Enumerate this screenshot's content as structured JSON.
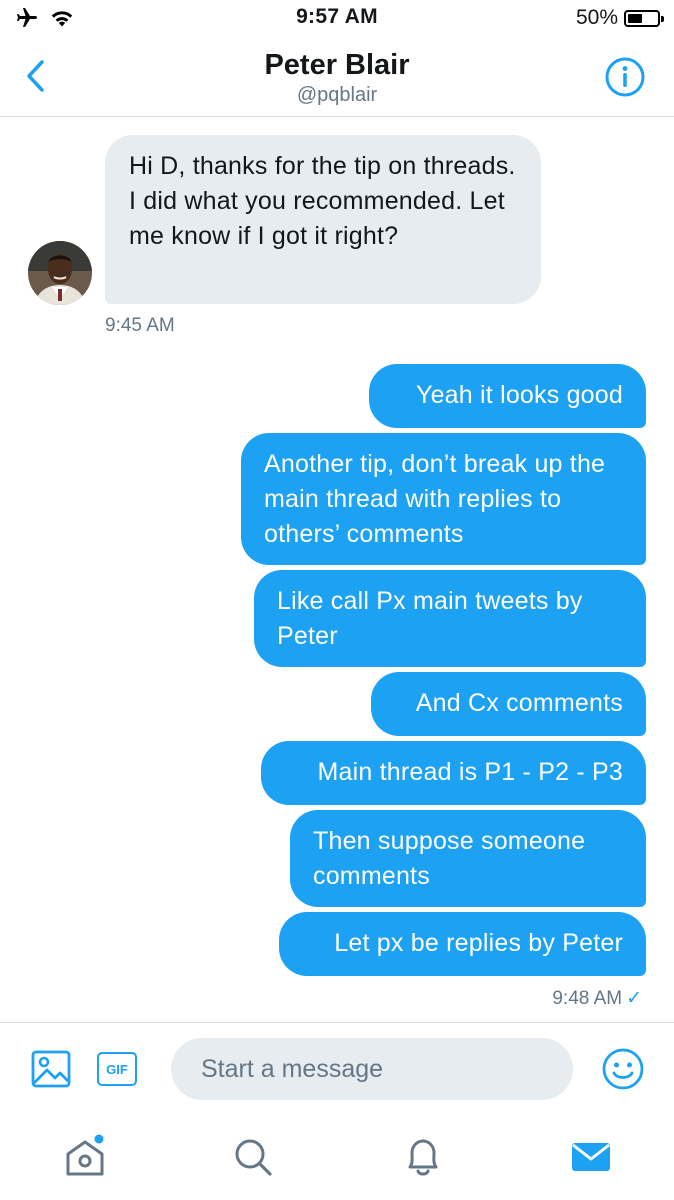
{
  "status_bar": {
    "time": "9:57 AM",
    "battery_percent_label": "50%",
    "battery_level": 0.5
  },
  "header": {
    "name": "Peter Blair",
    "handle": "@pqblair"
  },
  "messages": [
    {
      "direction": "in",
      "text": "Hi D, thanks for the tip on threads. I did what you recommended. Let me know if I got it right?"
    },
    {
      "direction": "out",
      "text": "Yeah it looks good"
    },
    {
      "direction": "out",
      "text": "Another tip, don’t break up the main thread with replies to others’ comments"
    },
    {
      "direction": "out",
      "text": "Like call Px main tweets by Peter"
    },
    {
      "direction": "out",
      "text": "And Cx comments"
    },
    {
      "direction": "out",
      "text": "Main thread is P1 - P2 - P3"
    },
    {
      "direction": "out",
      "text": "Then suppose someone comments"
    },
    {
      "direction": "out",
      "text": "Let px be replies by Peter"
    }
  ],
  "timestamps": {
    "received": "9:45 AM",
    "sent": "9:48 AM"
  },
  "composer": {
    "placeholder": "Start a message",
    "gif_label": "GIF"
  },
  "colors": {
    "accent": "#1da1f2",
    "incoming_bubble": "#e6ecf0",
    "secondary_text": "#657786"
  },
  "icons": {
    "status_left": [
      "airplane-icon",
      "wifi-icon"
    ],
    "header": [
      "back-chevron-icon",
      "info-icon"
    ],
    "composer": [
      "image-icon",
      "gif-icon",
      "emoji-icon"
    ],
    "tabs": [
      "home-icon",
      "search-icon",
      "notifications-icon",
      "messages-icon"
    ]
  }
}
